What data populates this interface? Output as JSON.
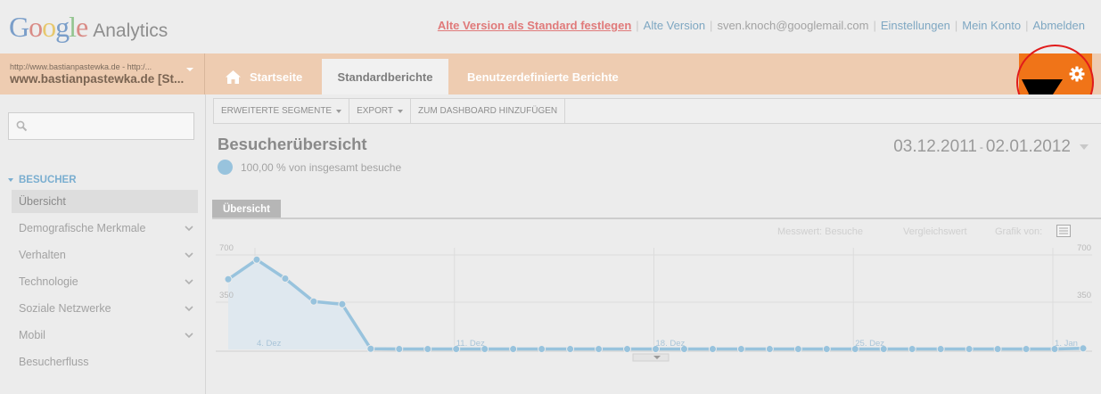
{
  "header": {
    "logo_google": "Google",
    "logo_product": "Analytics",
    "brand_colors": [
      "#7a9ec9",
      "#d98b86",
      "#e7c86e",
      "#7a9ec9",
      "#93c48f",
      "#d98b86"
    ],
    "links": {
      "set_default": "Alte Version als Standard festlegen",
      "old_version": "Alte Version",
      "email": "sven.knoch@googlemail.com",
      "settings": "Einstellungen",
      "account": "Mein Konto",
      "logout": "Abmelden"
    },
    "separator": "|"
  },
  "nav": {
    "profile_url": "http://www.bastianpastewka.de - http:/...",
    "profile_name": "www.bastianpastewka.de [St...",
    "tabs": {
      "home": "Startseite",
      "standard": "Standardberichte",
      "custom": "Benutzerdefinierte Berichte"
    },
    "accent_color": "#f07418",
    "highlight_color": "#e11b1b"
  },
  "sidebar": {
    "search_placeholder": "",
    "section": "BESUCHER",
    "items": [
      {
        "label": "Übersicht"
      },
      {
        "label": "Demografische Merkmale"
      },
      {
        "label": "Verhalten"
      },
      {
        "label": "Technologie"
      },
      {
        "label": "Soziale Netzwerke"
      },
      {
        "label": "Mobil"
      },
      {
        "label": "Besucherfluss"
      }
    ]
  },
  "toolbar": {
    "segments": "ERWEITERTE SEGMENTE",
    "export": "EXPORT",
    "dashboard": "ZUM DASHBOARD HINZUFÜGEN"
  },
  "report": {
    "title": "Besucherübersicht",
    "subtitle": "100,00 % von insgesamt besuche",
    "date_start": "03.12.2011",
    "date_dash": "-",
    "date_end": "02.01.2012",
    "subtab": "Übersicht"
  },
  "chart_controls": {
    "metric": "Messwert: Besuche",
    "compare": "Vergleichswert",
    "graph_by": "Grafik von:"
  },
  "chart_data": {
    "type": "area",
    "y_ticks": [
      "700",
      "350"
    ],
    "ylim": [
      0,
      700
    ],
    "x_tick_labels": [
      "4. Dez",
      "11. Dez",
      "18. Dez",
      "25. Dez",
      "1. Jan"
    ],
    "x_tick_indices": [
      1,
      8,
      15,
      22,
      29
    ],
    "series": [
      {
        "values": [
          520,
          665,
          525,
          355,
          335,
          5,
          3,
          3,
          3,
          3,
          3,
          3,
          3,
          3,
          3,
          3,
          3,
          3,
          3,
          3,
          3,
          3,
          3,
          3,
          3,
          3,
          3,
          3,
          3,
          3,
          8
        ]
      }
    ],
    "line_color": "#98c3dd",
    "fill_color": "#dfe8ef",
    "grid": true
  }
}
